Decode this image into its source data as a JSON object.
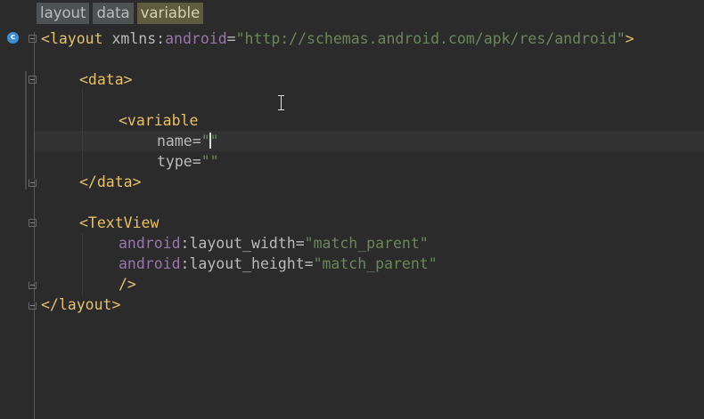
{
  "breadcrumbs": [
    {
      "label": "layout"
    },
    {
      "label": "data"
    },
    {
      "label": "variable"
    }
  ],
  "gutter": {
    "class_icon_letter": "c",
    "class_icon_name": "class-icon"
  },
  "code": {
    "l1": {
      "open": "<",
      "tag": "layout",
      "sp": " ",
      "attr": "xmlns",
      "colon": ":",
      "ns": "android",
      "eq": "=",
      "val": "\"http://schemas.android.com/apk/res/android\"",
      "close": ">"
    },
    "l3": {
      "text": "<data>"
    },
    "l5": {
      "text": "<variable"
    },
    "l6": {
      "attr": "name",
      "eq": "=",
      "q1": "\"",
      "q2": "\""
    },
    "l7": {
      "attr": "type",
      "eq": "=",
      "val": "\"\""
    },
    "l8": {
      "text": "</data>"
    },
    "l10": {
      "text": "<TextView"
    },
    "l11": {
      "ns": "android",
      "colon": ":",
      "attr": "layout_width",
      "eq": "=",
      "val": "\"match_parent\""
    },
    "l12": {
      "ns": "android",
      "colon": ":",
      "attr": "layout_height",
      "eq": "=",
      "val": "\"match_parent\""
    },
    "l13": {
      "text": "/>"
    },
    "l14": {
      "text": "</layout>"
    }
  },
  "colors": {
    "background": "#2b2b2b",
    "tag": "#e8bf6a",
    "attribute": "#bababa",
    "namespace": "#9876aa",
    "string": "#6a8759",
    "active_crumb": "#5f5b3f"
  }
}
